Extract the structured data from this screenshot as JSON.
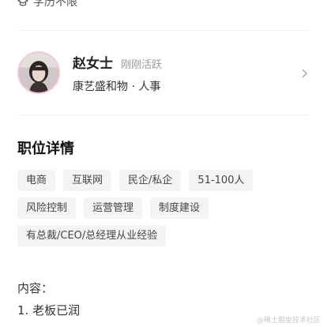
{
  "education": {
    "icon": "graduation-cap-icon",
    "text": "学历不限"
  },
  "recruiter": {
    "name": "赵女士",
    "status": "刚刚活跃",
    "company": "康艺盛和物 · 人事",
    "avatar_icon": "avatar",
    "action_icon": "chevron-right-icon"
  },
  "job_details": {
    "title": "职位详情",
    "tags": [
      "电商",
      "互联网",
      "民企/私企",
      "51-100人",
      "风险控制",
      "运营管理",
      "制度建设",
      "有总裁/CEO/总经理从业经验"
    ]
  },
  "content": {
    "label": "内容：",
    "lines": [
      "1. 老板已润"
    ]
  },
  "watermark": "@稀土掘金技术社区",
  "colors": {
    "divider": "#ececec",
    "tag_bg": "#f4f4f4",
    "muted_text": "#999999",
    "avatar_border": "#f2c9d4"
  }
}
